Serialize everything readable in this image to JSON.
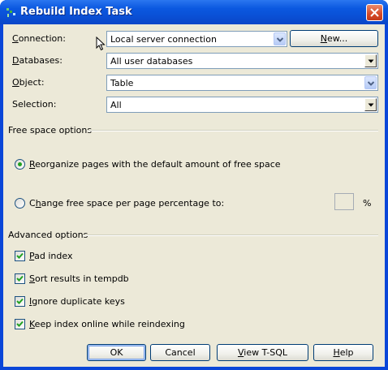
{
  "window": {
    "title": "Rebuild Index Task",
    "icon": "rebuild-index-icon",
    "close_icon": "close-icon"
  },
  "form": {
    "connection": {
      "label_key": "C",
      "label_rest": "onnection:",
      "value": "Local server connection",
      "new_button_key": "N",
      "new_button_rest": "ew..."
    },
    "databases": {
      "label_key": "D",
      "label_rest": "atabases:",
      "value": "All user databases"
    },
    "object": {
      "label_key": "O",
      "label_rest": "bject:",
      "value": "Table"
    },
    "selection": {
      "label_key": "",
      "label_rest": "Selection:",
      "value": "All"
    }
  },
  "free_space": {
    "title": "Free space options",
    "option1": {
      "key": "R",
      "rest": "eorganize pages with the default amount of free space",
      "checked": true
    },
    "option2": {
      "pre": "C",
      "key": "h",
      "rest": "ange free space per page percentage to:",
      "checked": false
    },
    "percent_value": "",
    "percent_symbol": "%"
  },
  "advanced": {
    "title": "Advanced options",
    "options": [
      {
        "key": "P",
        "rest": "ad index",
        "checked": true
      },
      {
        "key": "S",
        "rest": "ort results in tempdb",
        "checked": true
      },
      {
        "key": "I",
        "rest": "gnore duplicate keys",
        "checked": true
      },
      {
        "key": "K",
        "rest": "eep index online while reindexing",
        "checked": true
      }
    ]
  },
  "buttons": {
    "ok": "OK",
    "cancel": "Cancel",
    "view_tsql_key": "V",
    "view_tsql_rest": "iew T-SQL",
    "help_key": "H",
    "help_rest": "elp"
  }
}
